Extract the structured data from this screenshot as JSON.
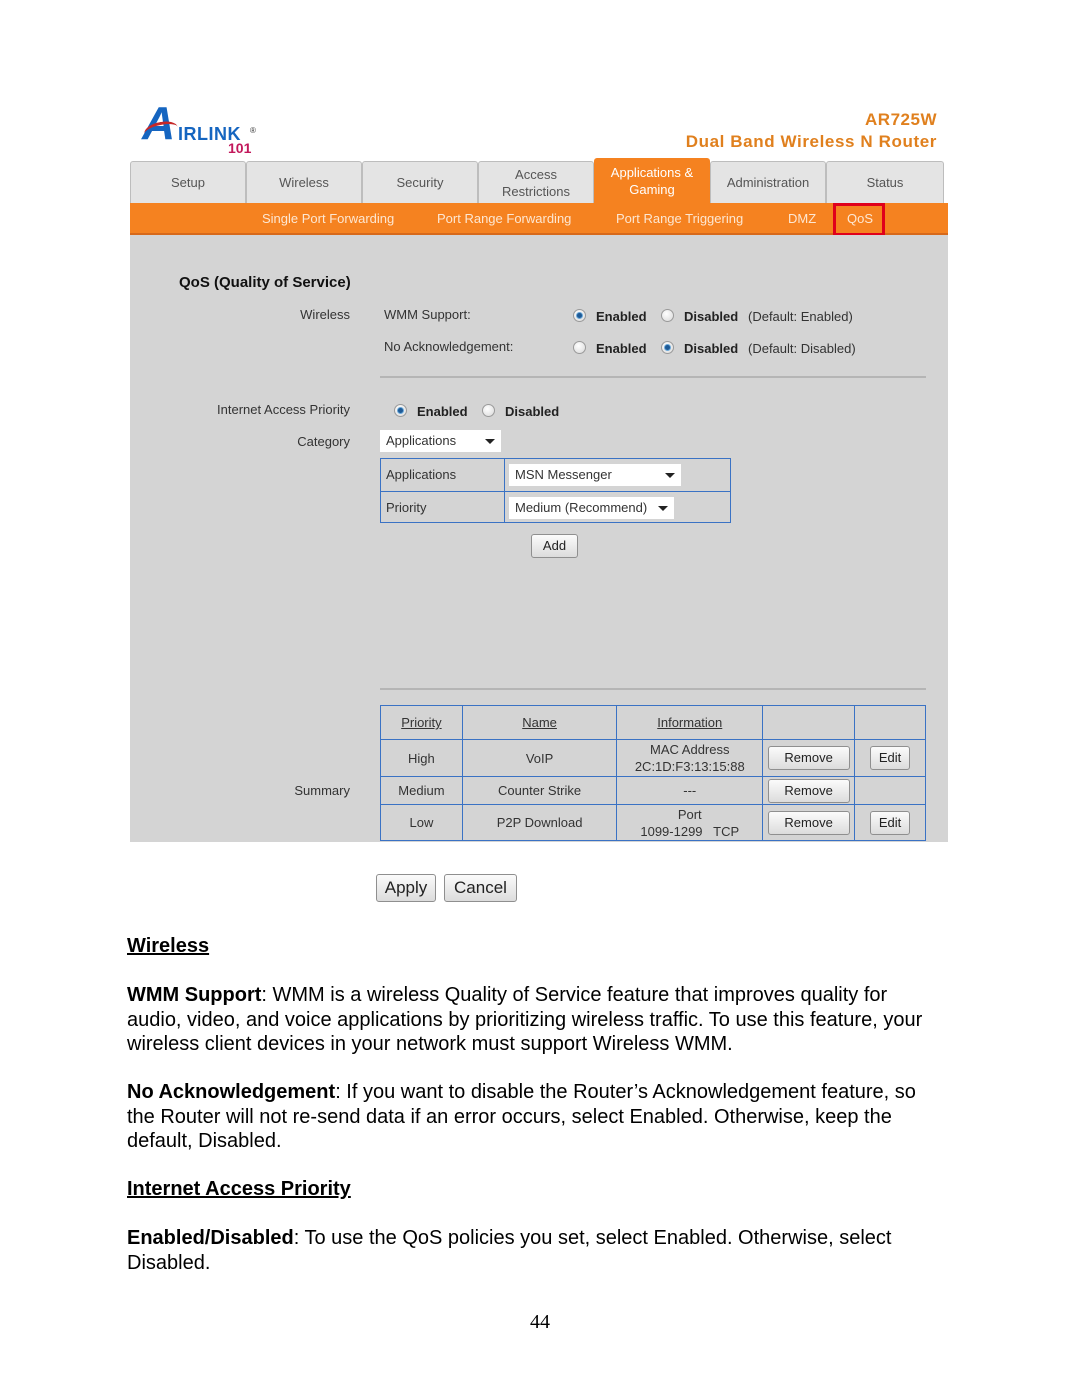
{
  "router": {
    "brand": {
      "mark": "A",
      "rest": "IRLINK",
      "registered": "®",
      "number": "101"
    },
    "model": "AR725W",
    "product": "Dual Band Wireless N Router",
    "colors": {
      "accent": "#f58220",
      "highlight_box": "#e0001b",
      "table_border": "#3a72c4",
      "panel": "#d4d4d4"
    },
    "tabs": [
      {
        "label": "Setup"
      },
      {
        "label": "Wireless"
      },
      {
        "label": "Security"
      },
      {
        "label": "Access Restrictions"
      },
      {
        "label": "Applications & Gaming",
        "active": true
      },
      {
        "label": "Administration"
      },
      {
        "label": "Status"
      }
    ],
    "subnav": [
      "Single Port Forwarding",
      "Port Range Forwarding",
      "Port Range Triggering",
      "DMZ",
      "QoS"
    ],
    "section_title": "QoS (Quality of Service)",
    "wireless": {
      "label": "Wireless",
      "wmm": {
        "label": "WMM Support:",
        "enabled": "Enabled",
        "disabled": "Disabled",
        "selected": "Enabled",
        "default": "(Default: Enabled)"
      },
      "noack": {
        "label": "No Acknowledgement:",
        "enabled": "Enabled",
        "disabled": "Disabled",
        "selected": "Disabled",
        "default": "(Default: Disabled)"
      }
    },
    "iap": {
      "label": "Internet Access Priority",
      "enabled": "Enabled",
      "disabled": "Disabled",
      "selected": "Enabled"
    },
    "category": {
      "label": "Category",
      "value": "Applications"
    },
    "applications": {
      "label": "Applications",
      "value": "MSN Messenger"
    },
    "priority": {
      "label": "Priority",
      "value": "Medium (Recommend)"
    },
    "add_label": "Add",
    "summary": {
      "label": "Summary",
      "headers": [
        "Priority",
        "Name",
        "Information"
      ],
      "rows": [
        {
          "priority": "High",
          "name": "VoIP",
          "info1": "MAC Address",
          "info2": "2C:1D:F3:13:15:88",
          "remove": "Remove",
          "edit": "Edit"
        },
        {
          "priority": "Medium",
          "name": "Counter Strike",
          "info1": "---",
          "info2": "",
          "remove": "Remove",
          "edit": ""
        },
        {
          "priority": "Low",
          "name": "P2P Download",
          "info1": "Port",
          "info2": "1099-1299   TCP",
          "remove": "Remove",
          "edit": "Edit"
        }
      ]
    },
    "apply_label": "Apply",
    "cancel_label": "Cancel"
  },
  "doc": {
    "h_wireless": "Wireless",
    "wmm_term": "WMM Support",
    "wmm_text": ": WMM is a wireless Quality of Service feature that improves quality for audio, video, and voice applications by prioritizing wireless traffic. To use this feature, your wireless client devices in your network must support Wireless WMM.",
    "noack_term": "No Acknowledgement",
    "noack_text": ": If you want to disable the Router’s Acknowledgement feature, so the Router will not re-send data if an error occurs, select Enabled. Otherwise, keep the default, Disabled.",
    "h_iap": "Internet Access Priority",
    "ed_term": "Enabled/Disabled",
    "ed_text": ": To use the QoS policies you set, select Enabled. Otherwise, select Disabled.",
    "page_number": "44"
  }
}
